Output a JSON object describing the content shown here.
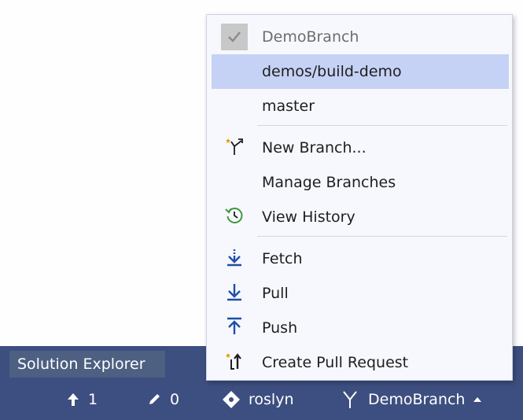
{
  "solution_explorer": {
    "tab_label": "Solution Explorer"
  },
  "branch_menu": {
    "items": [
      {
        "label": "DemoBranch",
        "icon": "checkmark-icon",
        "state": "current-disabled"
      },
      {
        "label": "demos/build-demo",
        "icon": "",
        "state": "highlighted"
      },
      {
        "label": "master",
        "icon": ""
      },
      {
        "label": "New Branch...",
        "icon": "new-branch-icon"
      },
      {
        "label": "Manage Branches",
        "icon": ""
      },
      {
        "label": "View History",
        "icon": "history-icon"
      },
      {
        "label": "Fetch",
        "icon": "fetch-icon"
      },
      {
        "label": "Pull",
        "icon": "pull-icon"
      },
      {
        "label": "Push",
        "icon": "push-icon"
      },
      {
        "label": "Create Pull Request",
        "icon": "pull-request-icon"
      }
    ]
  },
  "status_bar": {
    "unpushed_count": "1",
    "changes_count": "0",
    "repo_name": "roslyn",
    "branch_name": "DemoBranch"
  },
  "colors": {
    "status_bar_bg": "#3d4f80",
    "menu_bg": "#f7f8fd",
    "menu_highlight": "#c5d2f5",
    "icon_blue": "#1e4fa8",
    "icon_green": "#3d9b3d",
    "icon_orange": "#e0a000"
  }
}
